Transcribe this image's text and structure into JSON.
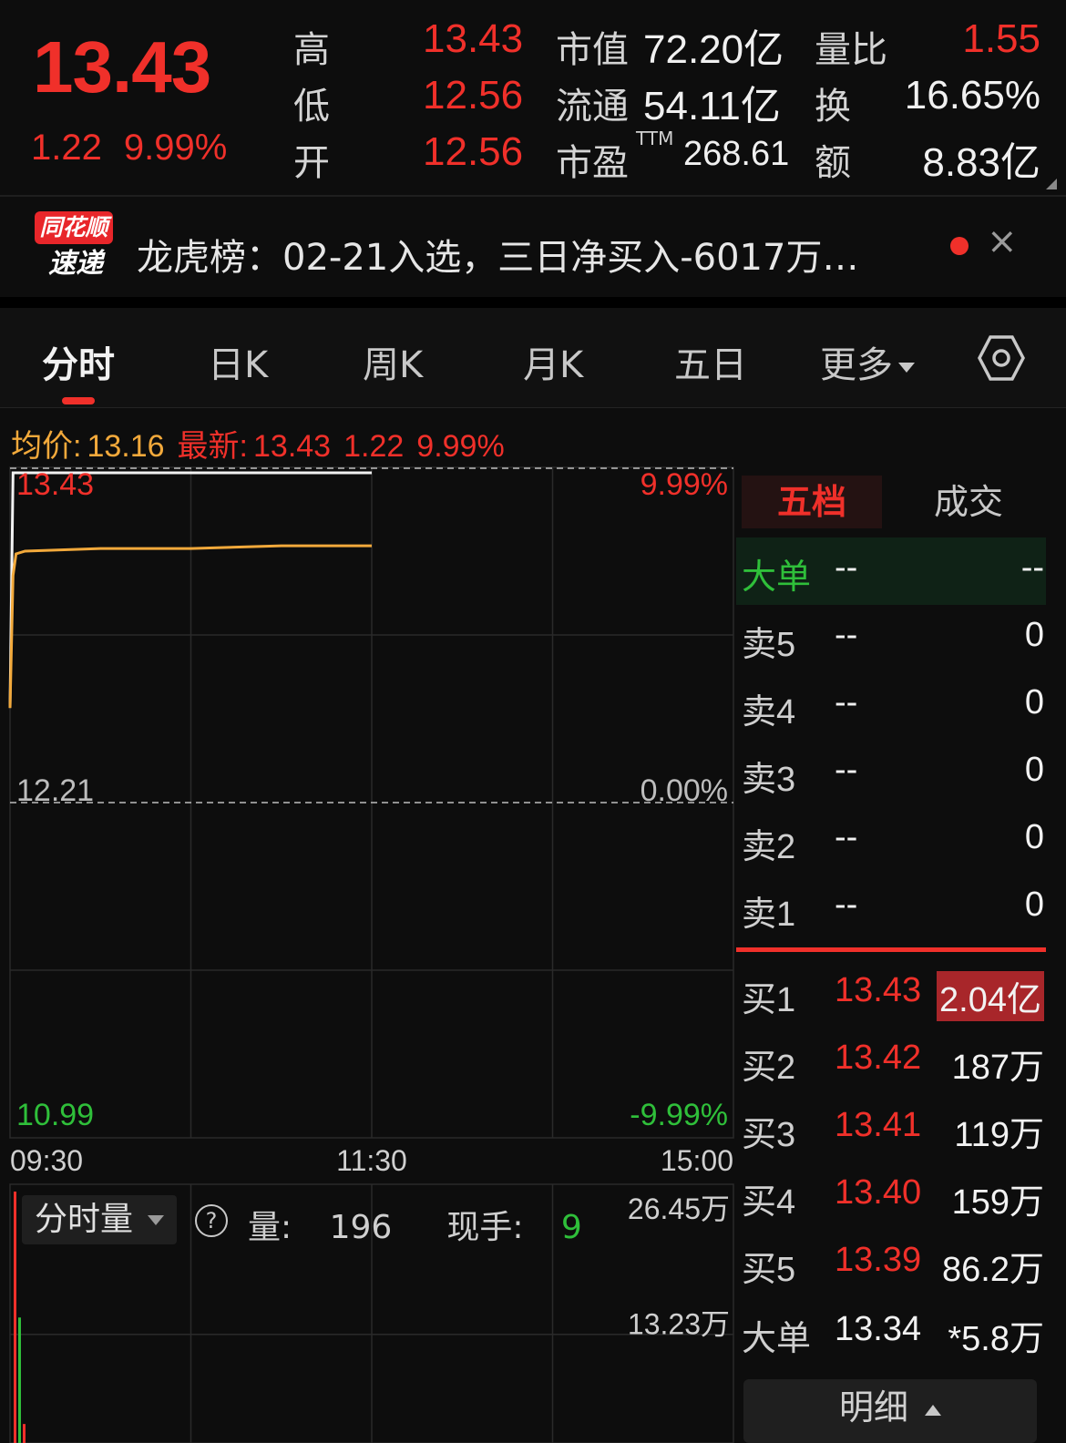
{
  "quote": {
    "price": "13.43",
    "change": "1.22",
    "change_pct": "9.99%",
    "high_label": "高",
    "high": "13.43",
    "low_label": "低",
    "low": "12.56",
    "open_label": "开",
    "open": "12.56",
    "mcap_label": "市值",
    "mcap": "72.20亿",
    "float_label": "流通",
    "float": "54.11亿",
    "pe_label": "市盈",
    "pe_sup": "TTM",
    "pe": "268.61",
    "volratio_label": "量比",
    "volratio": "1.55",
    "turnover_label": "换",
    "turnover": "16.65%",
    "amount_label": "额",
    "amount": "8.83亿"
  },
  "news": {
    "logo_top": "同花顺",
    "logo_bottom": "速递",
    "text": "龙虎榜：02-21入选，三日净买入-6017万…",
    "close": "×"
  },
  "tabs": [
    "分时",
    "日K",
    "周K",
    "月K",
    "五日",
    "更多"
  ],
  "chart_info": {
    "avg_label": "均价:",
    "avg": "13.16",
    "latest_label": "最新:",
    "latest": "13.43",
    "change": "1.22",
    "change_pct": "9.99%"
  },
  "chart_data": {
    "type": "line",
    "x_ticks": [
      "09:30",
      "11:30",
      "15:00"
    ],
    "ylim": [
      10.99,
      13.43
    ],
    "y_labels_left": [
      "13.43",
      "12.21",
      "10.99"
    ],
    "y_labels_right": [
      "9.99%",
      "0.00%",
      "-9.99%"
    ],
    "series": [
      {
        "name": "",
        "color": "#f2f2f2",
        "x": [
          "09:30",
          "09:31",
          "09:32",
          "09:35",
          "10:00",
          "10:30",
          "11:00",
          "11:30"
        ],
        "y": [
          12.56,
          13.43,
          13.43,
          13.43,
          13.43,
          13.43,
          13.43,
          13.43
        ]
      },
      {
        "name": "",
        "color": "#f2a93b",
        "x": [
          "09:30",
          "09:31",
          "09:32",
          "09:35",
          "10:00",
          "10:30",
          "11:00",
          "11:30"
        ],
        "y": [
          12.56,
          13.05,
          13.13,
          13.14,
          13.15,
          13.15,
          13.16,
          13.16
        ]
      }
    ],
    "volume": {
      "ylabels": [
        "26.45万",
        "13.23万"
      ],
      "bars": [
        {
          "x": "09:30",
          "value": 26.45,
          "color": "#f0302a"
        },
        {
          "x": "09:31",
          "value": 13.2,
          "color": "#2fbf3a"
        },
        {
          "x": "09:32",
          "value": 2.0,
          "color": "#f0302a"
        }
      ]
    }
  },
  "volume_panel": {
    "selector": "分时量",
    "help": "?",
    "vol_label": "量:",
    "vol": "196",
    "hand_label": "现手:",
    "hand": "9"
  },
  "order_book": {
    "tab_wudang": "五档",
    "tab_trades": "成交",
    "big_order_top": {
      "label": "大单",
      "price": "--",
      "vol": "--"
    },
    "sells": [
      {
        "label": "卖5",
        "price": "--",
        "vol": "0"
      },
      {
        "label": "卖4",
        "price": "--",
        "vol": "0"
      },
      {
        "label": "卖3",
        "price": "--",
        "vol": "0"
      },
      {
        "label": "卖2",
        "price": "--",
        "vol": "0"
      },
      {
        "label": "卖1",
        "price": "--",
        "vol": "0"
      }
    ],
    "buys": [
      {
        "label": "买1",
        "price": "13.43",
        "vol": "2.04亿"
      },
      {
        "label": "买2",
        "price": "13.42",
        "vol": "187万"
      },
      {
        "label": "买3",
        "price": "13.41",
        "vol": "119万"
      },
      {
        "label": "买4",
        "price": "13.40",
        "vol": "159万"
      },
      {
        "label": "买5",
        "price": "13.39",
        "vol": "86.2万"
      }
    ],
    "big_order_bottom": {
      "label": "大单",
      "price": "13.34",
      "vol": "*5.8万"
    },
    "detail": "明细"
  },
  "colors": {
    "up": "#f0302a",
    "down": "#2fbf3a",
    "avg": "#f2a93b",
    "price_line": "#f2f2f2"
  }
}
